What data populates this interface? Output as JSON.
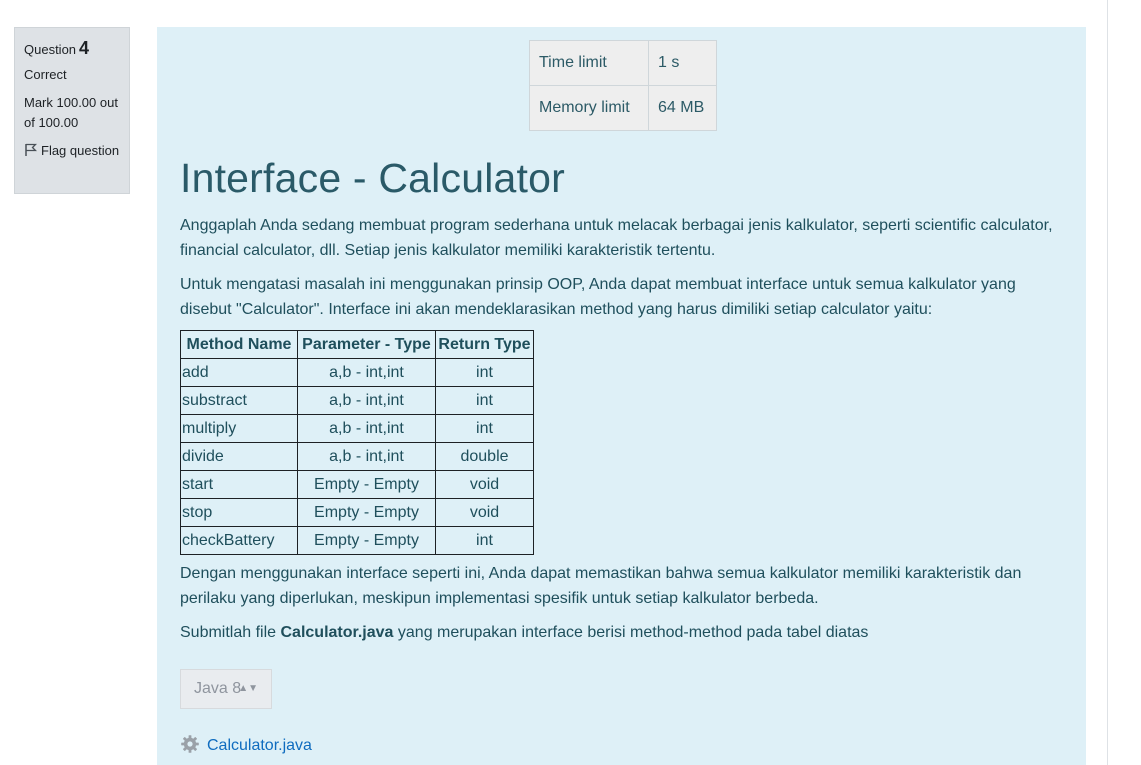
{
  "question_info": {
    "question_label": "Question",
    "question_number": "4",
    "state": "Correct",
    "grade": "Mark 100.00 out of 100.00",
    "flag_label": "Flag question",
    "flag_icon": "flag-icon"
  },
  "limits": {
    "time_label": "Time limit",
    "time_value": "1 s",
    "memory_label": "Memory limit",
    "memory_value": "64 MB"
  },
  "title": "Interface - Calculator",
  "paragraph1": "Anggaplah Anda sedang membuat program sederhana untuk melacak berbagai jenis kalkulator, seperti scientific calculator, financial calculator, dll. Setiap jenis kalkulator memiliki karakteristik tertentu.",
  "paragraph2": "Untuk mengatasi masalah ini menggunakan prinsip OOP, Anda dapat membuat interface untuk semua kalkulator yang disebut \"Calculator\". Interface ini akan mendeklarasikan method yang harus dimiliki setiap calculator yaitu:",
  "table": {
    "headers": [
      "Method Name",
      "Parameter - Type",
      "Return Type"
    ],
    "rows": [
      [
        "add",
        "a,b - int,int",
        "int"
      ],
      [
        "substract",
        "a,b - int,int",
        "int"
      ],
      [
        "multiply",
        "a,b - int,int",
        "int"
      ],
      [
        "divide",
        "a,b - int,int",
        "double"
      ],
      [
        "start",
        "Empty - Empty",
        "void"
      ],
      [
        "stop",
        "Empty - Empty",
        "void"
      ],
      [
        "checkBattery",
        "Empty - Empty",
        "int"
      ]
    ]
  },
  "paragraph3": "Dengan menggunakan interface seperti ini, Anda dapat memastikan bahwa semua kalkulator memiliki karakteristik dan perilaku yang diperlukan, meskipun implementasi spesifik untuk setiap kalkulator berbeda.",
  "paragraph4": {
    "before": "Submitlah file ",
    "bold": "Calculator.java",
    "after": " yang merupakan interface berisi method-method pada tabel diatas"
  },
  "language_select": {
    "value": "Java 8",
    "arrows": "▲▼"
  },
  "file": {
    "name": "Calculator.java",
    "icon": "gear-icon"
  },
  "colors": {
    "content_bg": "#def0f7",
    "info_bg": "#dee2e6",
    "link": "#0f6cbf",
    "title": "#2a5a68"
  }
}
